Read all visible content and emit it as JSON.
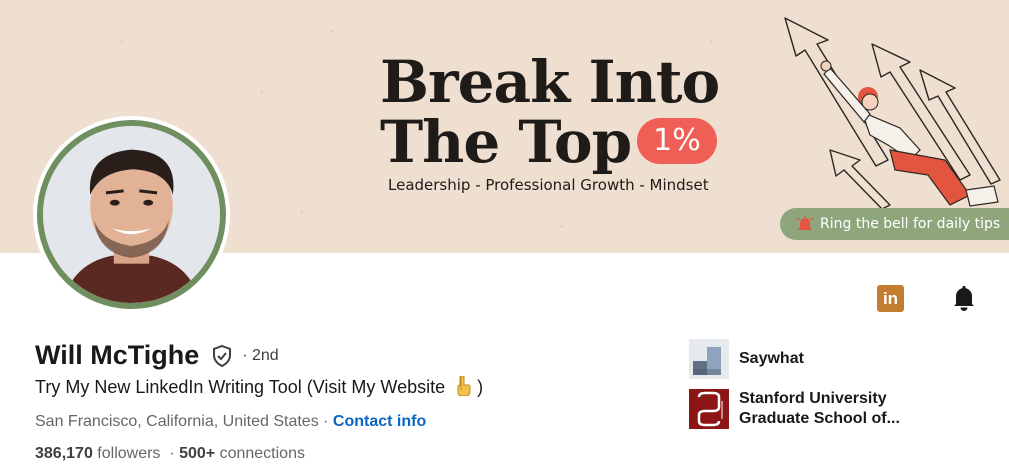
{
  "banner": {
    "headline_line1": "Break Into",
    "headline_line2": "The Top",
    "headline_badge": "1%",
    "tagline": "Leadership - Professional Growth - Mindset",
    "bell_tip": "Ring the bell for daily tips",
    "colors": {
      "background": "#efdfd0",
      "accent_red": "#ef5f55",
      "tip_green": "#8fa67d"
    }
  },
  "profile": {
    "name": "Will McTighe",
    "verified_icon": "shield-check-icon",
    "degree": "· 2nd",
    "headline": "Try My New LinkedIn Writing Tool (Visit My Website",
    "headline_emoji": "pointing-down-emoji",
    "headline_close": ")",
    "location": "San Francisco, California, United States",
    "location_sep": " · ",
    "contact_link": "Contact info",
    "followers_count": "386,170",
    "followers_label": " followers",
    "connections_sep": "  · ",
    "connections_count": "500+",
    "connections_label": " connections",
    "avatar_ring_color": "#6f8f5f"
  },
  "actions": {
    "linkedin_badge": "in",
    "linkedin_color": "#c37d2f",
    "bell_icon": "bell-icon"
  },
  "organizations": [
    {
      "name": "Saywhat",
      "logo_icon": "saywhat-logo"
    },
    {
      "name": "Stanford University Graduate School of...",
      "logo_icon": "stanford-gsb-logo"
    }
  ],
  "colors": {
    "link": "#0a66c2",
    "secondary_text": "#666666"
  }
}
